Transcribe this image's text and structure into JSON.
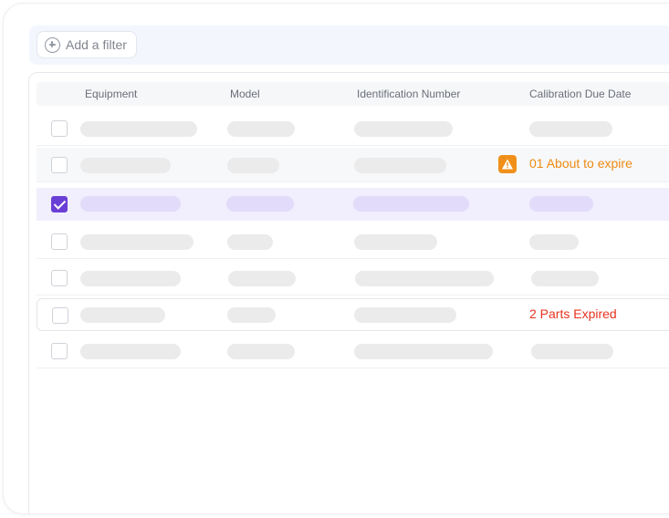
{
  "filter": {
    "add_label": "Add a filter"
  },
  "table": {
    "columns": [
      "Equipment",
      "Model",
      "Identification Number",
      "Calibration Due Date"
    ],
    "rows": [
      {
        "checked": false,
        "status": ""
      },
      {
        "checked": false,
        "status": "01 About to expire",
        "status_type": "warning"
      },
      {
        "checked": true,
        "status": ""
      },
      {
        "checked": false,
        "status": ""
      },
      {
        "checked": false,
        "status": ""
      },
      {
        "checked": false,
        "status": "2 Parts Expired",
        "status_type": "expired"
      },
      {
        "checked": false,
        "status": ""
      }
    ]
  },
  "colors": {
    "accent": "#6a3fd6",
    "warning": "#ee8a12",
    "expired": "#e8331e",
    "filter_bar_bg": "#f3f7fd",
    "selected_row_bg": "#f1eefd"
  },
  "icons": {
    "add_filter": "plus-circle-icon",
    "warning": "warning-triangle-icon",
    "check": "checkmark-icon"
  }
}
